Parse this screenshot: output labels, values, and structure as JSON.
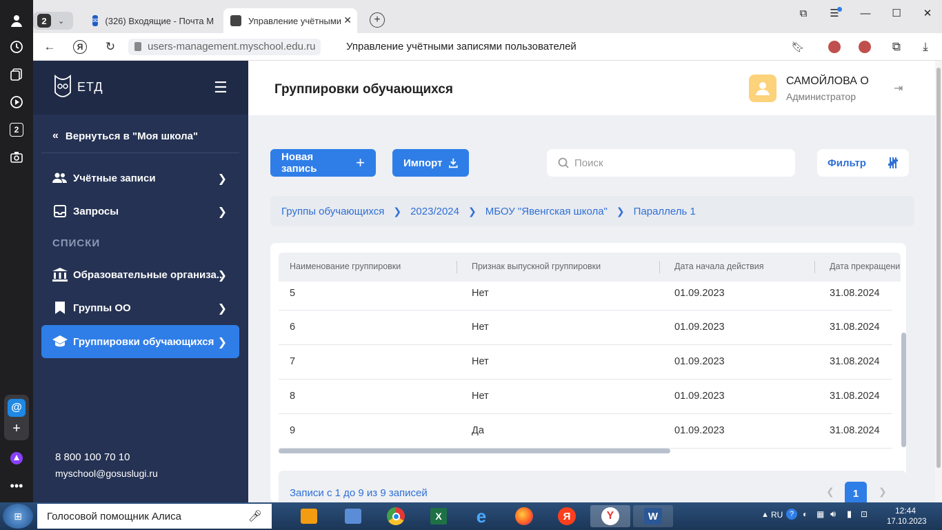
{
  "browser": {
    "tab_count": "2",
    "tabs": [
      {
        "label": "(326) Входящие - Почта М"
      },
      {
        "label": "Управление учётными"
      }
    ],
    "rail_badge": "2",
    "url": "users-management.myschool.edu.ru",
    "page_title": "Управление учётными записями пользователей"
  },
  "sidebar": {
    "logo_text": "ЕТД",
    "back_label": "Вернуться в \"Моя школа\"",
    "section_label": "СПИСКИ",
    "items": [
      {
        "label": "Учётные записи"
      },
      {
        "label": "Запросы"
      },
      {
        "label": "Образовательные организа..."
      },
      {
        "label": "Группы ОО"
      },
      {
        "label": "Группировки обучающихся"
      }
    ],
    "phone": "8 800 100 70 10",
    "email": "myschool@gosuslugi.ru"
  },
  "header": {
    "title": "Группировки обучающихся",
    "user_name": "САМОЙЛОВА О",
    "user_role": "Администратор"
  },
  "toolbar": {
    "new_label": "Новая запись",
    "import_label": "Импорт",
    "search_placeholder": "Поиск",
    "filter_label": "Фильтр"
  },
  "breadcrumbs": [
    "Группы обучающихся",
    "2023/2024",
    "МБОУ \"Явенгская школа\"",
    "Параллель 1"
  ],
  "table": {
    "columns": [
      "Наименование группировки",
      "Признак выпускной группировки",
      "Дата начала действия",
      "Дата прекращени"
    ],
    "rows": [
      [
        "5",
        "Нет",
        "01.09.2023",
        "31.08.2024"
      ],
      [
        "6",
        "Нет",
        "01.09.2023",
        "31.08.2024"
      ],
      [
        "7",
        "Нет",
        "01.09.2023",
        "31.08.2024"
      ],
      [
        "8",
        "Нет",
        "01.09.2023",
        "31.08.2024"
      ],
      [
        "9",
        "Да",
        "01.09.2023",
        "31.08.2024"
      ]
    ],
    "footer_text": "Записи с 1 до 9 из 9 записей",
    "current_page": "1"
  },
  "taskbar": {
    "assistant_text": "Голосовой помощник Алиса",
    "lang": "RU",
    "time": "12:44",
    "date": "17.10.2023"
  },
  "colors": {
    "accent": "#2f7ee8",
    "sidebar": "#253253",
    "link": "#2f6fd6"
  }
}
